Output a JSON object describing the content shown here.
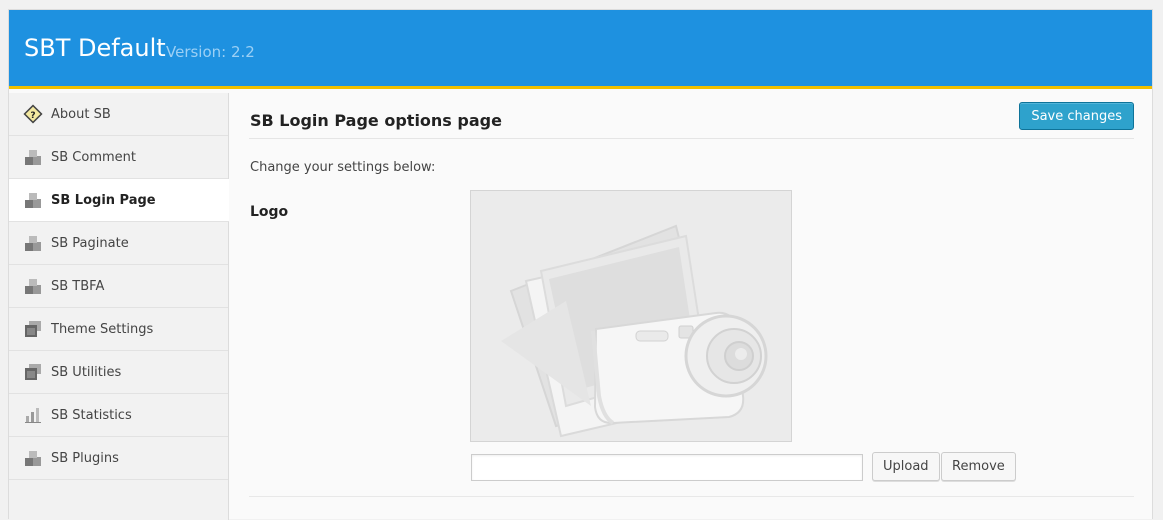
{
  "app": {
    "title": "SBT Default",
    "version": "Version: 2.2"
  },
  "colors": {
    "topbar": "#1e91e0",
    "accent_stripe": "#f0c000",
    "primary_button": "#2ea2cc"
  },
  "sidebar": {
    "items": [
      {
        "label": "About SB",
        "icon": "diamond-info-icon",
        "active": false
      },
      {
        "label": "SB Comment",
        "icon": "plugin-blocks-icon",
        "active": false
      },
      {
        "label": "SB Login Page",
        "icon": "plugin-blocks-icon",
        "active": true
      },
      {
        "label": "SB Paginate",
        "icon": "plugin-blocks-icon",
        "active": false
      },
      {
        "label": "SB TBFA",
        "icon": "plugin-blocks-icon",
        "active": false
      },
      {
        "label": "Theme Settings",
        "icon": "theme-windows-icon",
        "active": false
      },
      {
        "label": "SB Utilities",
        "icon": "theme-windows-icon",
        "active": false
      },
      {
        "label": "SB Statistics",
        "icon": "bar-chart-icon",
        "active": false
      },
      {
        "label": "SB Plugins",
        "icon": "plugin-blocks-icon",
        "active": false
      }
    ]
  },
  "main": {
    "heading": "SB Login Page options page",
    "save_label": "Save changes",
    "subtitle": "Change your settings below:",
    "logo": {
      "label": "Logo",
      "input_value": "",
      "upload_label": "Upload",
      "remove_label": "Remove",
      "preview_icon": "camera-photos-placeholder-icon"
    }
  }
}
